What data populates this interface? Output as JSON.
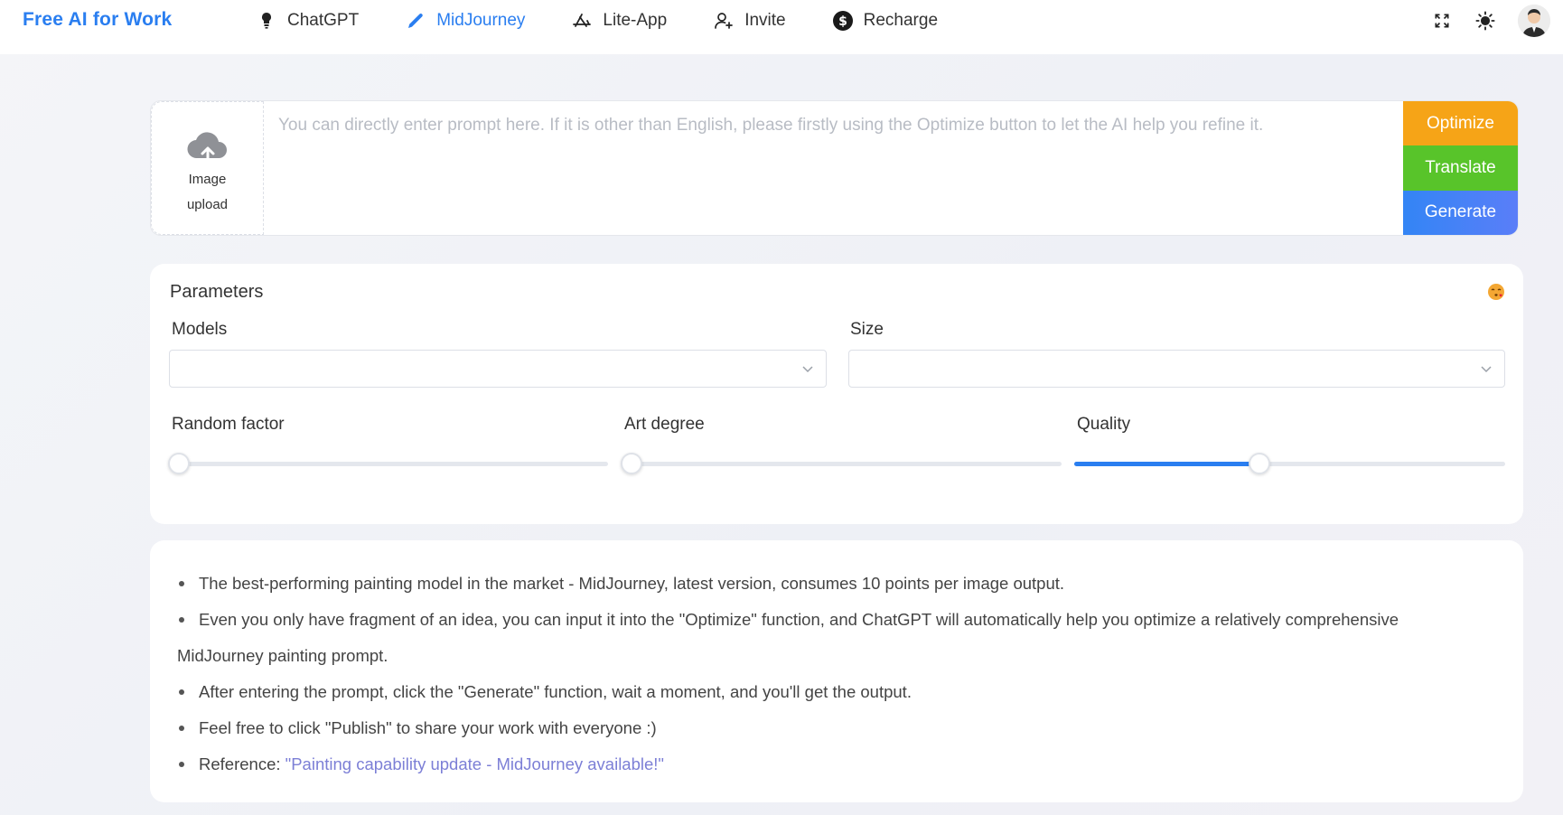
{
  "brand": "Free AI for Work",
  "nav": [
    {
      "label": "ChatGPT",
      "icon": "lightbulb-icon"
    },
    {
      "label": "MidJourney",
      "icon": "pencil-icon",
      "active": true
    },
    {
      "label": "Lite-App",
      "icon": "app-store-icon"
    },
    {
      "label": "Invite",
      "icon": "user-plus-icon"
    },
    {
      "label": "Recharge",
      "icon": "dollar-icon"
    }
  ],
  "top_right": {
    "fullscreen_icon": "fullscreen-icon",
    "theme_icon": "sun-icon",
    "avatar_icon": "avatar-icon"
  },
  "prompt": {
    "placeholder": "You can directly enter prompt here. If it is other than English, please firstly using the Optimize button to let the AI help you refine it.",
    "value": "",
    "upload_label": "Image upload",
    "buttons": {
      "optimize": "Optimize",
      "translate": "Translate",
      "generate": "Generate"
    },
    "colors": {
      "optimize": "#f6a417",
      "translate": "#58c42a",
      "generate": "#3385f5"
    }
  },
  "parameters": {
    "title": "Parameters",
    "models_label": "Models",
    "models_value": "",
    "size_label": "Size",
    "size_value": "",
    "random_label": "Random factor",
    "random_value": 0,
    "art_label": "Art degree",
    "art_value": 0,
    "quality_label": "Quality",
    "quality_value": 0.43
  },
  "info": {
    "item1": "The best-performing painting model in the market - MidJourney, latest version, consumes 10 points per image output.",
    "item2a": "Even you only have fragment of an idea, you can input it into the \"Optimize\" function, and ChatGPT will automatically help you optimize a relatively comprehensive",
    "item2b": "MidJourney painting prompt.",
    "item3": "After entering the prompt, click the \"Generate\" function, wait a moment, and you'll get the output.",
    "item4": "Feel free to click \"Publish\" to share your work with everyone :)",
    "ref_label": "Reference:",
    "ref_link": "\"Painting capability update - MidJourney available!\""
  }
}
